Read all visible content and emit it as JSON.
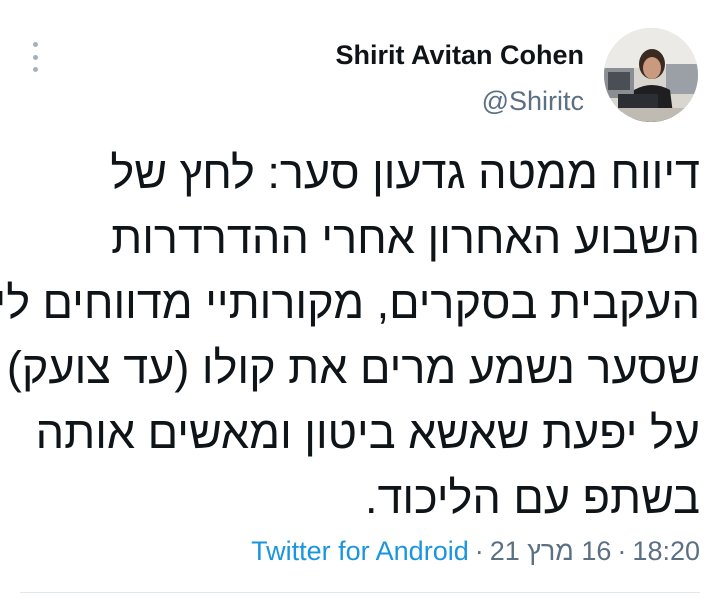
{
  "author": {
    "display_name": "Shirit Avitan Cohen",
    "handle": "@Shiritc"
  },
  "tweet": {
    "lines": [
      "דיווח ממטה גדעון סער: לחץ של",
      "השבוע האחרון אחרי ההדרדרות",
      "העקבית בסקרים, מקורותיי מדווחים לי",
      "שסער נשמע מרים את קולו (עד צועק)",
      "על יפעת שאשא ביטון ומאשים אותה",
      "בשתפ עם הליכוד."
    ]
  },
  "meta": {
    "time": "18:20",
    "date": "16 מרץ 21",
    "separator": "·",
    "source": "Twitter for Android"
  },
  "icons": {
    "more": "more-vertical-icon"
  },
  "colors": {
    "text": "#0f1419",
    "secondary": "#5b7083",
    "link": "#1b95e0"
  }
}
